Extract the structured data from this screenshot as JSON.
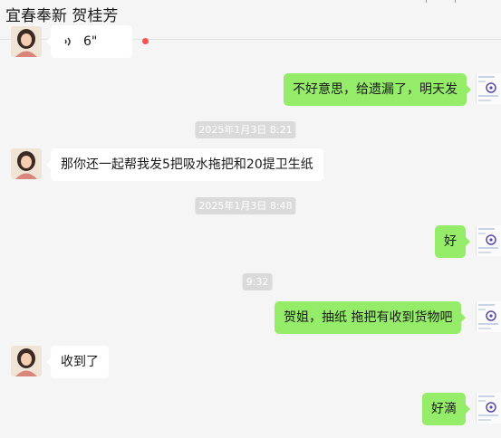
{
  "window": {
    "title": "宜春奉新 贺桂芳"
  },
  "colors": {
    "background": "#f5f5f5",
    "incoming_bubble": "#ffffff",
    "outgoing_bubble": "#95ec69",
    "timestamp_bg": "#dadada",
    "unread_dot": "#fa5151"
  },
  "messages": [
    {
      "direction": "in",
      "kind": "voice",
      "text": "6\""
    },
    {
      "direction": "out",
      "text": "不好意思，给遗漏了，明天发"
    },
    {
      "kind": "time",
      "text": "2025年1月3日 8:21"
    },
    {
      "direction": "in",
      "text": "那你还一起帮我发5把吸水拖把和20提卫生纸"
    },
    {
      "kind": "time",
      "text": "2025年1月3日 8:48"
    },
    {
      "direction": "out",
      "text": "好"
    },
    {
      "kind": "time",
      "text": "9:32"
    },
    {
      "direction": "out",
      "text": "贺姐，抽纸  拖把有收到货物吧"
    },
    {
      "direction": "in",
      "text": "收到了"
    },
    {
      "direction": "out",
      "text": "好滴"
    }
  ]
}
